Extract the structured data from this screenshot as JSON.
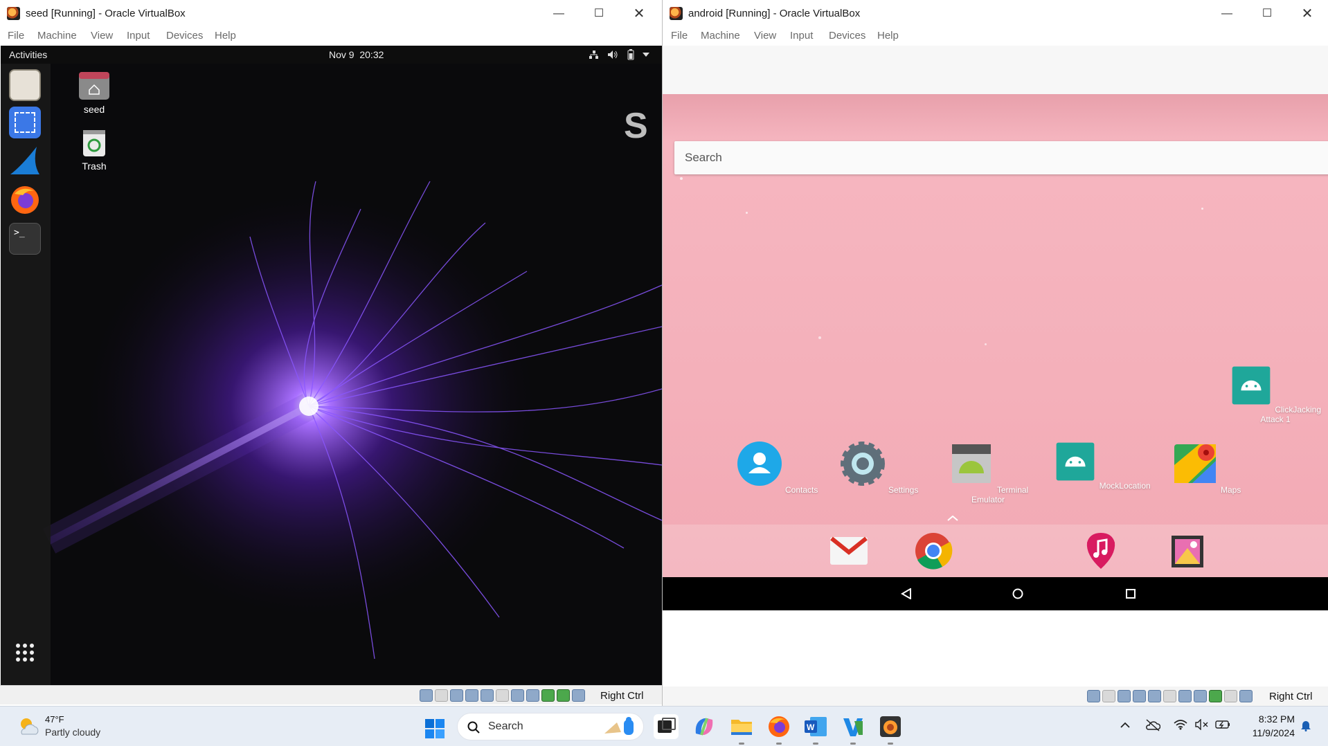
{
  "seed_window": {
    "title": "seed [Running] - Oracle VirtualBox",
    "menu": [
      "File",
      "Machine",
      "View",
      "Input",
      "Devices",
      "Help"
    ],
    "host_key": "Right Ctrl"
  },
  "ubuntu": {
    "activities": "Activities",
    "clock": "Nov 9  20:32",
    "desktop_icons": [
      {
        "label": "seed",
        "icon": "home-folder-icon"
      },
      {
        "label": "Trash",
        "icon": "trash-icon"
      }
    ],
    "dock": [
      "files-icon",
      "screenshot-icon",
      "wireshark-icon",
      "firefox-icon",
      "terminal-icon",
      "show-apps-icon"
    ],
    "partial_text": "S"
  },
  "android_window": {
    "title": "android [Running] - Oracle VirtualBox",
    "menu": [
      "File",
      "Machine",
      "View",
      "Input",
      "Devices",
      "Help"
    ],
    "host_key": "Right Ctrl"
  },
  "android": {
    "search_placeholder": "Search",
    "apps": [
      {
        "label": "Contacts",
        "icon": "contacts-icon"
      },
      {
        "label": "Settings",
        "icon": "settings-icon"
      },
      {
        "label": "Terminal Emulator",
        "icon": "terminal-emulator-icon"
      },
      {
        "label": "MockLocation",
        "icon": "android-app-icon"
      },
      {
        "label": "Maps",
        "icon": "maps-icon"
      },
      {
        "label": "ClickJacking Attack 1",
        "icon": "android-app-icon"
      }
    ],
    "dock_apps": [
      "gmail-icon",
      "chrome-icon",
      "music-icon",
      "gallery-icon"
    ],
    "nav": [
      "back-icon",
      "home-icon",
      "recents-icon"
    ]
  },
  "taskbar": {
    "weather_temp": "47°F",
    "weather_desc": "Partly cloudy",
    "search_label": "Search",
    "time": "8:32 PM",
    "date": "11/9/2024"
  },
  "colors": {
    "android_bg": "#f4b0ba",
    "ubuntu_accent": "#7b3fe4",
    "dock_bg": "#191919"
  }
}
